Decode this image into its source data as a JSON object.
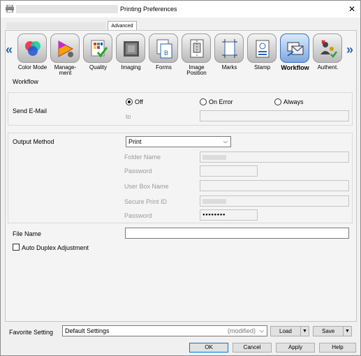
{
  "window": {
    "title": "Printing Preferences",
    "close_glyph": "✕"
  },
  "tabs": {
    "active": "Advanced"
  },
  "nav": {
    "prev_glyph": "«",
    "next_glyph": "»",
    "items": [
      {
        "label": "Color Mode",
        "icon": "color-mode-icon"
      },
      {
        "label": "Manage-\nment",
        "icon": "management-icon"
      },
      {
        "label": "Quality",
        "icon": "quality-icon"
      },
      {
        "label": "Imaging",
        "icon": "imaging-icon"
      },
      {
        "label": "Forms",
        "icon": "forms-icon"
      },
      {
        "label": "Image\nPosition",
        "icon": "image-position-icon"
      },
      {
        "label": "Marks",
        "icon": "marks-icon"
      },
      {
        "label": "Stamp",
        "icon": "stamp-icon"
      },
      {
        "label": "Workflow",
        "icon": "workflow-icon",
        "active": true
      },
      {
        "label": "Authent.",
        "icon": "authentication-icon"
      }
    ]
  },
  "workflow": {
    "section_title": "Workflow",
    "send_email": {
      "label": "Send E-Mail",
      "options": [
        "Off",
        "On Error",
        "Always"
      ],
      "selected": "Off",
      "to_label": "to",
      "to_value": ""
    },
    "output_method": {
      "label": "Output Method",
      "selected": "Print",
      "folder_name_label": "Folder Name",
      "password_label": "Password",
      "user_box_name_label": "User Box Name",
      "secure_print_id_label": "Secure Print ID",
      "password2_label": "Password",
      "password2_value": "●●●●●●●●"
    },
    "file_name": {
      "label": "File Name",
      "value": ""
    },
    "auto_duplex": {
      "label": "Auto Duplex Adjustment",
      "checked": false
    }
  },
  "favorite": {
    "label": "Favorite Setting",
    "value": "Default Settings",
    "modified": "(modified)",
    "load_label": "Load",
    "save_label": "Save"
  },
  "footer": {
    "ok": "OK",
    "cancel": "Cancel",
    "apply": "Apply",
    "help": "Help"
  },
  "colors": {
    "accent": "#2a62b0",
    "active_icon": "#7ea8de"
  }
}
